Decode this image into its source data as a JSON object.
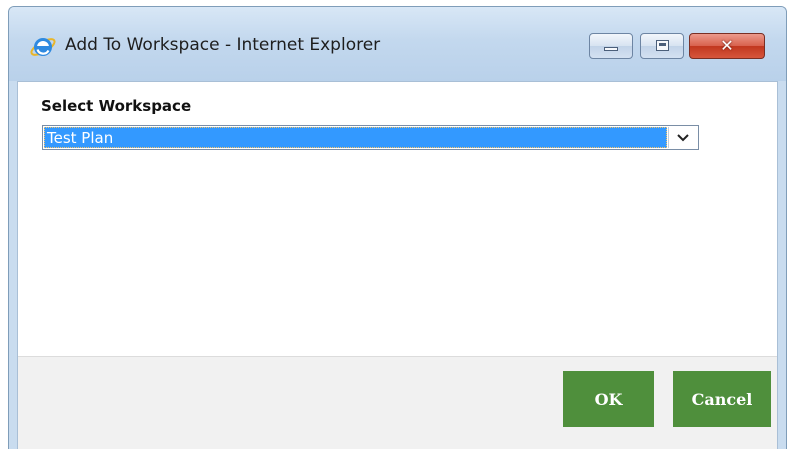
{
  "window": {
    "title": "Add To Workspace - Internet Explorer",
    "app_icon": "internet-explorer-icon",
    "controls": {
      "minimize_icon": "minimize-icon",
      "maximize_icon": "maximize-icon",
      "close_glyph": "✕"
    }
  },
  "form": {
    "label": "Select Workspace",
    "select": {
      "selected_value": "Test Plan",
      "arrow_icon": "chevron-down-icon"
    }
  },
  "footer": {
    "ok_label": "OK",
    "cancel_label": "Cancel"
  },
  "colors": {
    "selection_highlight": "#3399ff",
    "button_green": "#4f8f3c",
    "close_red": "#c1371f"
  }
}
